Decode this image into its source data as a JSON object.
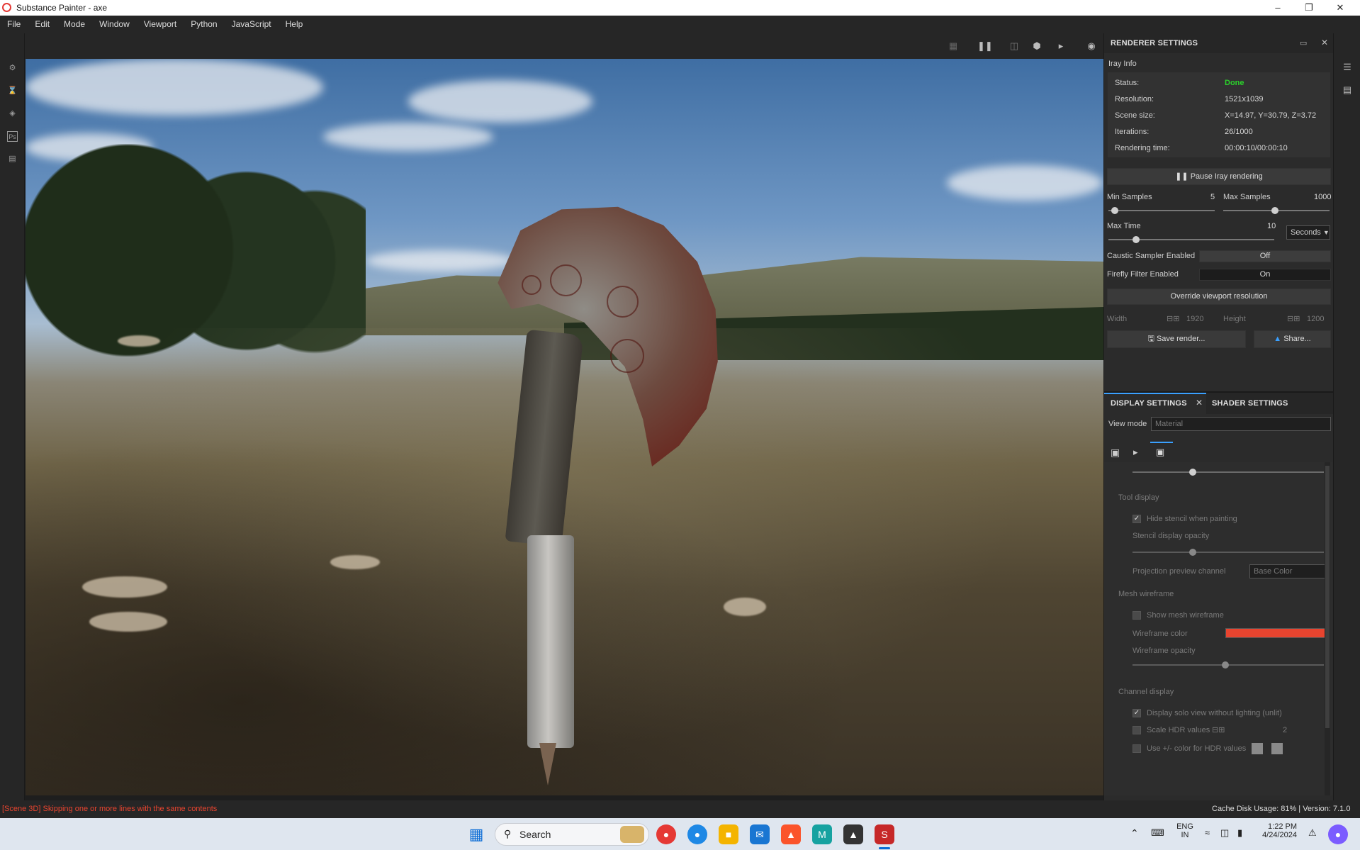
{
  "window": {
    "title": "Substance Painter - axe",
    "minimize_icon": "minimize-icon",
    "maximize_icon": "restore-icon",
    "close_icon": "close-icon"
  },
  "menu": {
    "items": [
      "File",
      "Edit",
      "Mode",
      "Window",
      "Viewport",
      "Python",
      "JavaScript",
      "Help"
    ]
  },
  "renderer": {
    "title": "RENDERER SETTINGS",
    "section": "Iray Info",
    "status_label": "Status:",
    "status_value": "Done",
    "status_color": "#2bd12b",
    "resolution_label": "Resolution:",
    "resolution_value": "1521x1039",
    "scene_label": "Scene size:",
    "scene_value": "X=14.97, Y=30.79, Z=3.72",
    "iter_label": "Iterations:",
    "iter_value": "26/1000",
    "time_label": "Rendering time:",
    "time_value": "00:00:10/00:00:10",
    "pause_label": "Pause Iray rendering",
    "min_samples_label": "Min Samples",
    "min_samples_value": "5",
    "max_samples_label": "Max Samples",
    "max_samples_value": "1000",
    "max_time_label": "Max Time",
    "max_time_value": "10",
    "time_unit": "Seconds",
    "caustic_label": "Caustic Sampler Enabled",
    "caustic_value": "Off",
    "firefly_label": "Firefly Filter Enabled",
    "firefly_value": "On",
    "override_label": "Override viewport resolution",
    "width_label": "Width",
    "width_value": "1920",
    "height_label": "Height",
    "height_value": "1200",
    "save_label": "Save render...",
    "share_label": "Share..."
  },
  "display": {
    "tab_display": "DISPLAY SETTINGS",
    "tab_shader": "SHADER SETTINGS",
    "view_mode_label": "View mode",
    "view_mode_value": "Material",
    "tool_display": "Tool display",
    "hide_stencil": "Hide stencil when painting",
    "stencil_opacity": "Stencil display opacity",
    "projection_label": "Projection preview channel",
    "projection_value": "Base Color",
    "mesh_wireframe": "Mesh wireframe",
    "show_mesh": "Show mesh wireframe",
    "wire_color_label": "Wireframe color",
    "wire_color": "#e8442f",
    "wire_opacity": "Wireframe opacity",
    "channel_display": "Channel display",
    "solo_view": "Display solo view without lighting (unlit)",
    "scale_hdr": "Scale HDR values",
    "scale_hdr_value": "2",
    "use_color_hdr": "Use +/- color for HDR values"
  },
  "status": {
    "message": "[Scene 3D] Skipping one or more lines with the same contents",
    "message_color": "#e8442f",
    "cache": "Cache Disk Usage:   81%  |  Version: 7.1.0"
  },
  "taskbar": {
    "search_placeholder": "Search",
    "lang_top": "ENG",
    "lang_bottom": "IN",
    "time": "1:22 PM",
    "date": "4/24/2024"
  }
}
